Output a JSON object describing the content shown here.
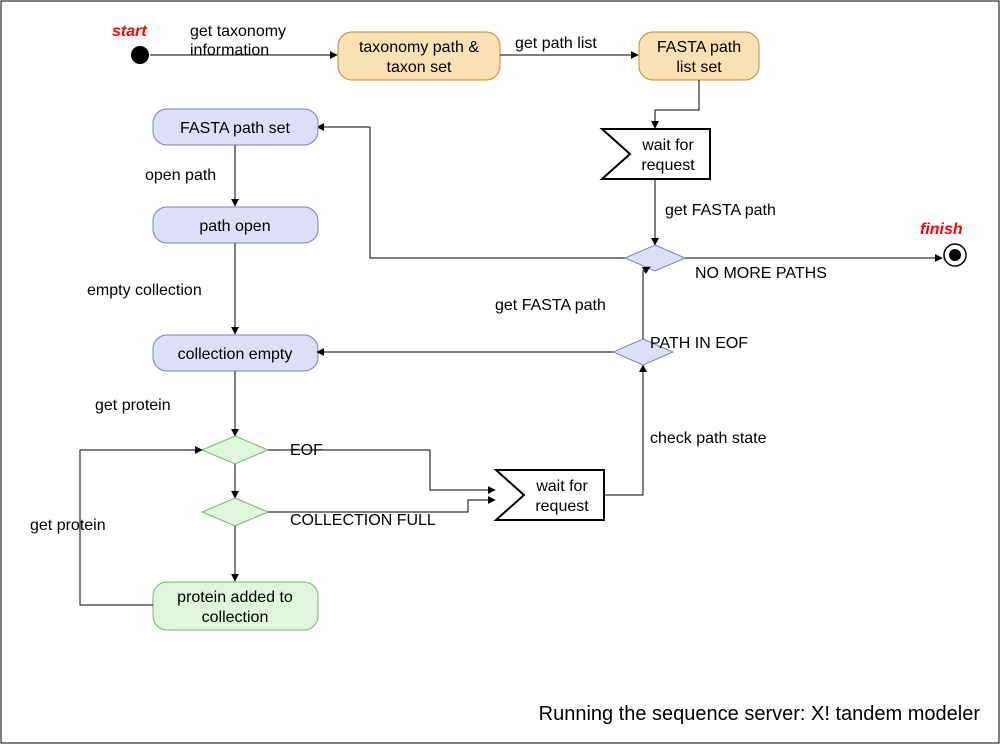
{
  "caption": "Running the sequence server: X! tandem modeler",
  "start_label": "start",
  "finish_label": "finish",
  "nodes": {
    "taxonomy": {
      "line1": "taxonomy path &",
      "line2": "taxon set"
    },
    "fasta_list": {
      "line1": "FASTA path",
      "line2": "list set"
    },
    "fasta_set": "FASTA path set",
    "path_open": "path open",
    "collection_empty": "collection empty",
    "protein_added": {
      "line1": "protein added to",
      "line2": "collection"
    },
    "wait1": {
      "line1": "wait for",
      "line2": "request"
    },
    "wait2": {
      "line1": "wait for",
      "line2": "request"
    }
  },
  "edges": {
    "get_taxonomy": {
      "line1": "get taxonomy",
      "line2": "information"
    },
    "get_path_list": "get path list",
    "get_fasta_path_top": "get FASTA path",
    "no_more_paths": "NO MORE PATHS",
    "get_fasta_path_mid": "get FASTA path",
    "path_in_eof": "PATH IN EOF",
    "open_path": "open path",
    "empty_collection": "empty collection",
    "get_protein_left": "get protein",
    "get_protein_loop": "get protein",
    "eof": "EOF",
    "collection_full": "COLLECTION FULL",
    "check_path_state": "check path state"
  }
}
